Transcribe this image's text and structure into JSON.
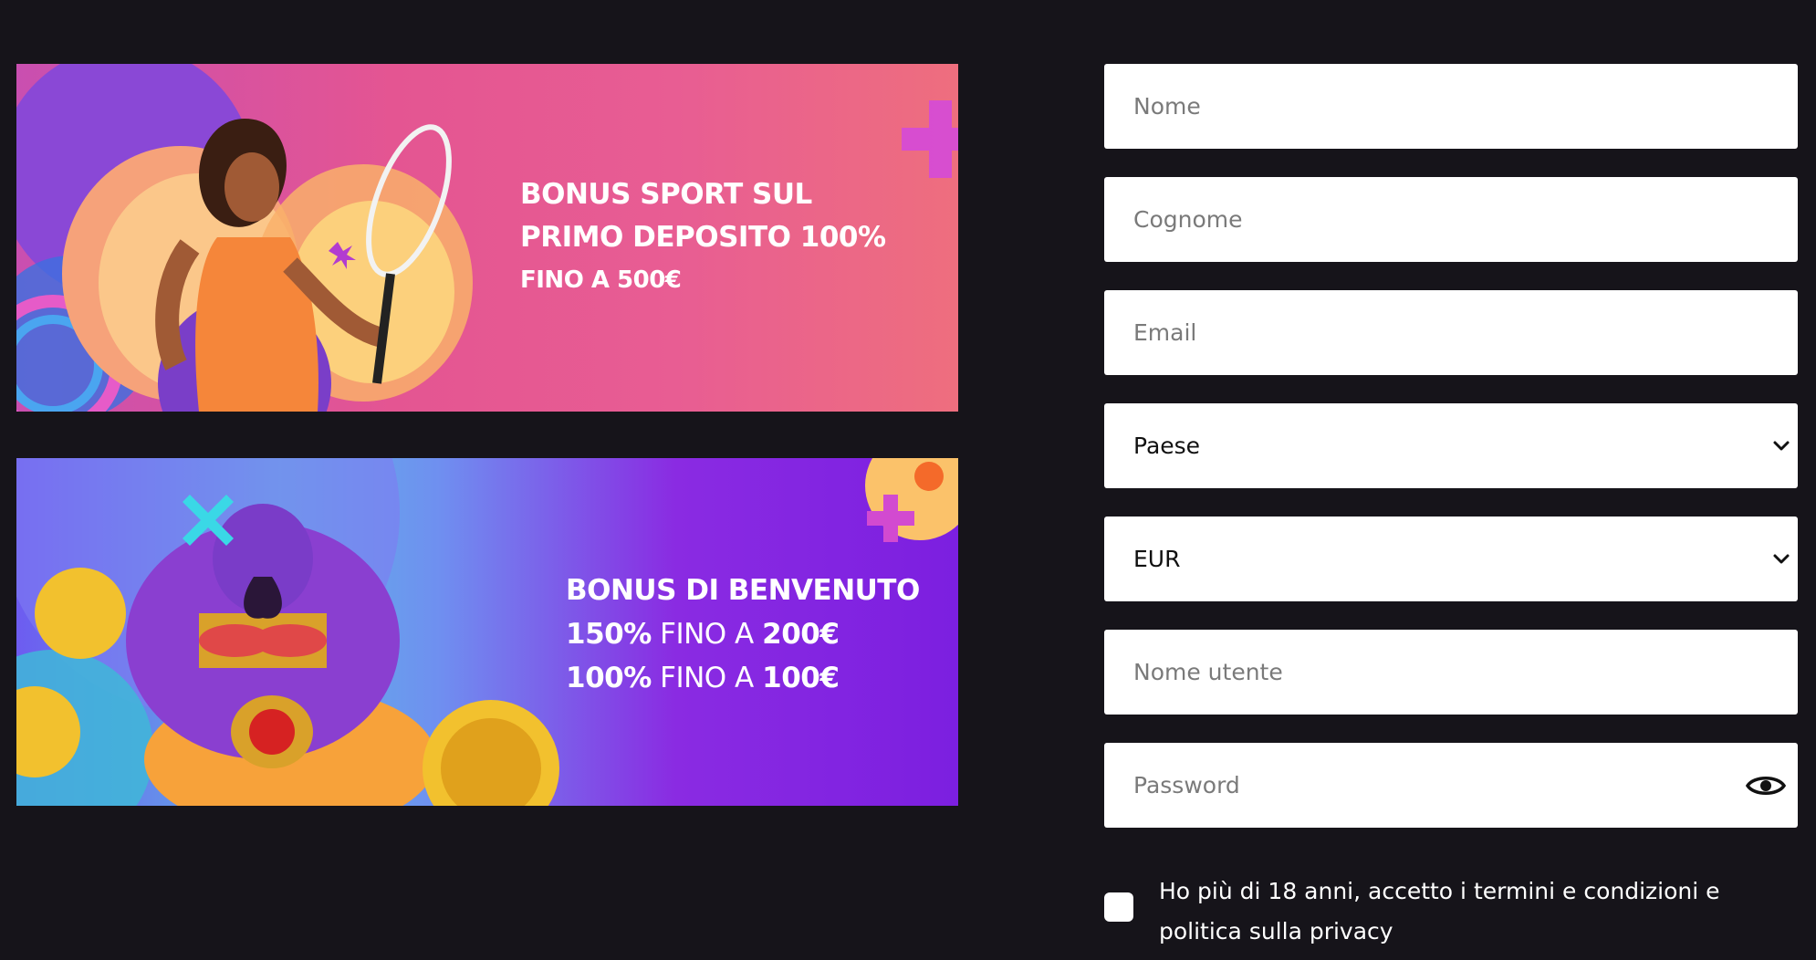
{
  "banners": {
    "sport": {
      "line1": "BONUS SPORT SUL",
      "line2": "PRIMO DEPOSITO 100%",
      "line3": "FINO A 500€"
    },
    "casino": {
      "line1": "BONUS DI BENVENUTO",
      "row1_pct": "150%",
      "row1_mid": " FINO A ",
      "row1_amt": "200€",
      "row2_pct": "100%",
      "row2_mid": " FINO A ",
      "row2_amt": "100€"
    }
  },
  "form": {
    "first_name_placeholder": "Nome",
    "last_name_placeholder": "Cognome",
    "email_placeholder": "Email",
    "country_value": "Paese",
    "currency_value": "EUR",
    "username_placeholder": "Nome utente",
    "password_placeholder": "Password",
    "consent_text": "Ho più di 18 anni, accetto i termini e condizioni e politica sulla privacy"
  },
  "icons": {
    "country_dropdown": "chevron-down-icon",
    "currency_dropdown": "chevron-down-icon",
    "password_toggle": "eye-icon"
  },
  "colors": {
    "background": "#16141a",
    "sport_banner": "#e45592",
    "casino_banner": "#7c1fe0",
    "field_bg": "#ffffff"
  }
}
